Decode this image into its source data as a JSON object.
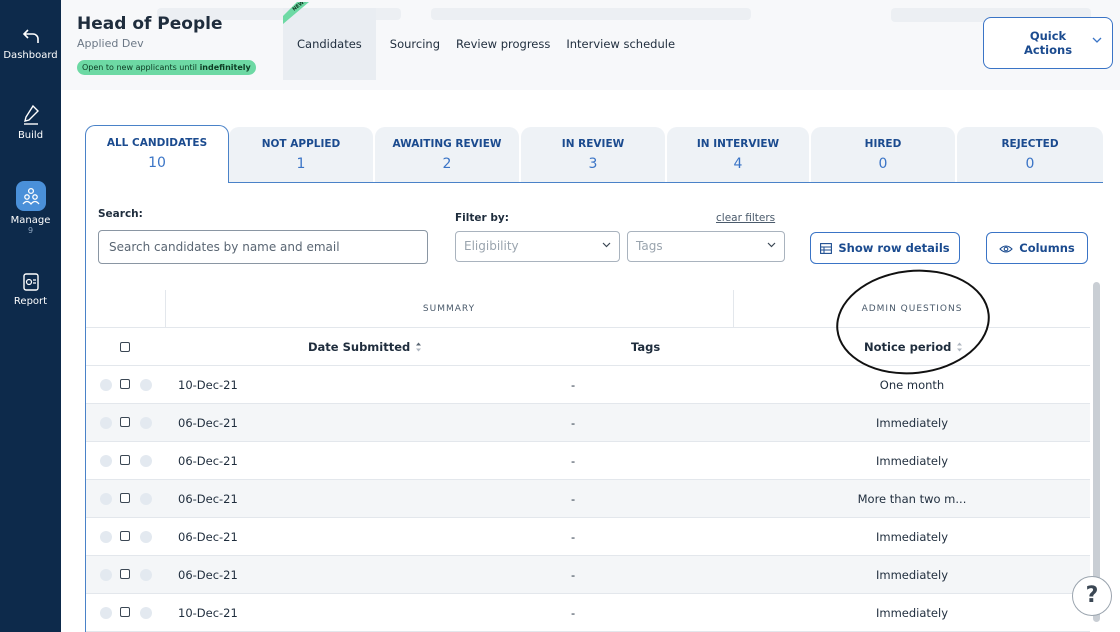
{
  "sidebar": {
    "items": [
      {
        "label": "Dashboard",
        "icon": "back-arrow-icon"
      },
      {
        "label": "Build",
        "icon": "pencil-icon"
      },
      {
        "label": "Manage",
        "icon": "people-icon",
        "sub": "9",
        "active": true
      },
      {
        "label": "Report",
        "icon": "report-icon"
      }
    ]
  },
  "header": {
    "title": "Head of People",
    "subtitle": "Applied Dev",
    "status_prefix": "Open to new applicants until",
    "status_value": "indefinitely",
    "new_badge": "NEW!",
    "tabs": [
      "Candidates",
      "Sourcing",
      "Review progress",
      "Interview schedule"
    ],
    "active_tab": "Candidates",
    "quick_actions_line1": "Quick",
    "quick_actions_line2": "Actions"
  },
  "status_tabs": [
    {
      "label": "ALL CANDIDATES",
      "count": "10"
    },
    {
      "label": "NOT APPLIED",
      "count": "1"
    },
    {
      "label": "AWAITING REVIEW",
      "count": "2"
    },
    {
      "label": "IN REVIEW",
      "count": "3"
    },
    {
      "label": "IN INTERVIEW",
      "count": "4"
    },
    {
      "label": "HIRED",
      "count": "0"
    },
    {
      "label": "REJECTED",
      "count": "0"
    }
  ],
  "search": {
    "label": "Search:",
    "placeholder": "Search candidates by name and email"
  },
  "filters": {
    "label": "Filter by:",
    "clear": "clear filters",
    "eligibility": "Eligibility",
    "tags": "Tags"
  },
  "buttons": {
    "row_details": "Show row details",
    "columns": "Columns"
  },
  "table": {
    "group_summary": "SUMMARY",
    "group_admin": "ADMIN QUESTIONS",
    "col_date": "Date Submitted",
    "col_tags": "Tags",
    "col_notice": "Notice period",
    "rows": [
      {
        "date": "10-Dec-21",
        "tags": "-",
        "notice": "One month"
      },
      {
        "date": "06-Dec-21",
        "tags": "-",
        "notice": "Immediately"
      },
      {
        "date": "06-Dec-21",
        "tags": "-",
        "notice": "Immediately"
      },
      {
        "date": "06-Dec-21",
        "tags": "-",
        "notice": "More than two m..."
      },
      {
        "date": "06-Dec-21",
        "tags": "-",
        "notice": "Immediately"
      },
      {
        "date": "06-Dec-21",
        "tags": "-",
        "notice": "Immediately"
      },
      {
        "date": "10-Dec-21",
        "tags": "-",
        "notice": "Immediately"
      }
    ]
  },
  "help": "?",
  "colors": {
    "sidebar": "#0d2a4b",
    "accent": "#3a74c6",
    "active_nav": "#4a90d9",
    "status_green": "#6dd9a4"
  }
}
